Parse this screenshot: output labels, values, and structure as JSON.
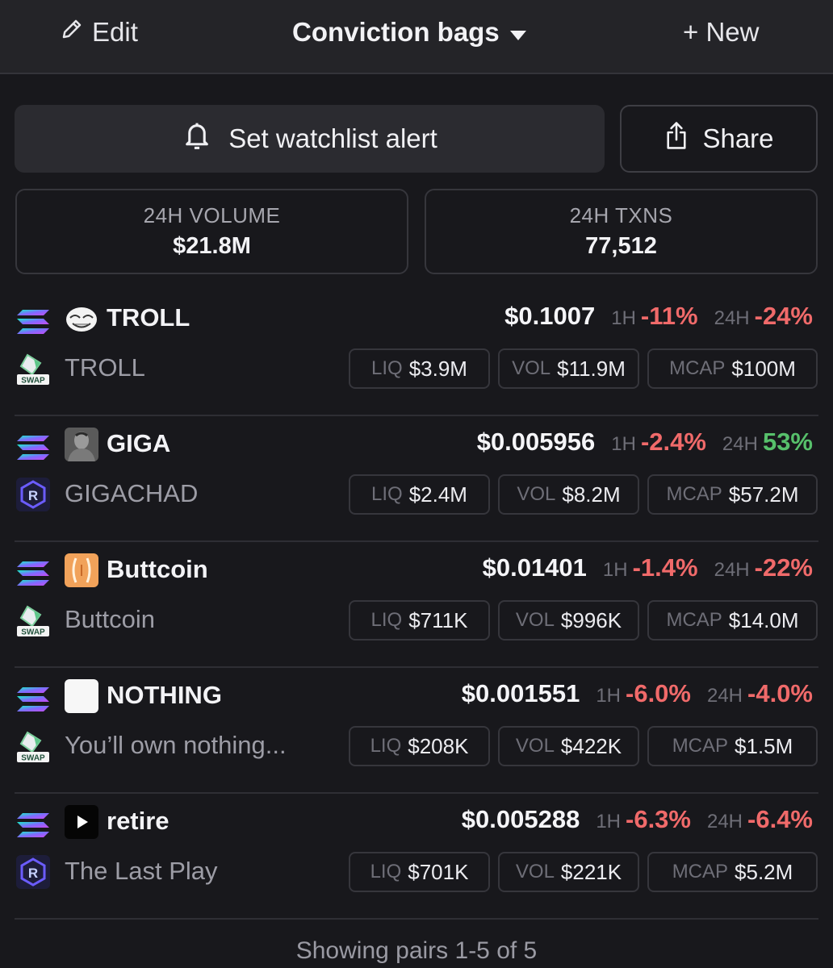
{
  "topbar": {
    "edit_label": "Edit",
    "title": "Conviction bags",
    "new_label": "+ New"
  },
  "actions": {
    "alert_label": "Set watchlist alert",
    "share_label": "Share"
  },
  "stats": {
    "volume_label": "24H VOLUME",
    "volume_value": "$21.8M",
    "txns_label": "24H TXNS",
    "txns_value": "77,512"
  },
  "pairs": [
    {
      "symbol": "TROLL",
      "name": "TROLL",
      "dex": "swap-icon",
      "token_icon": "trollface-icon",
      "price": "$0.1007",
      "h1_label": "1H",
      "h1": "-11%",
      "h1_dir": "neg",
      "h24_label": "24H",
      "h24": "-24%",
      "h24_dir": "neg",
      "liq_label": "LIQ",
      "liq": "$3.9M",
      "vol_label": "VOL",
      "vol": "$11.9M",
      "mcap_label": "MCAP",
      "mcap": "$100M"
    },
    {
      "symbol": "GIGA",
      "name": "GIGACHAD",
      "dex": "raydium-icon",
      "token_icon": "gigachad-icon",
      "price": "$0.005956",
      "h1_label": "1H",
      "h1": "-2.4%",
      "h1_dir": "neg",
      "h24_label": "24H",
      "h24": "53%",
      "h24_dir": "pos",
      "liq_label": "LIQ",
      "liq": "$2.4M",
      "vol_label": "VOL",
      "vol": "$8.2M",
      "mcap_label": "MCAP",
      "mcap": "$57.2M"
    },
    {
      "symbol": "Buttcoin",
      "name": "Buttcoin",
      "dex": "swap-icon",
      "token_icon": "buttcoin-icon",
      "price": "$0.01401",
      "h1_label": "1H",
      "h1": "-1.4%",
      "h1_dir": "neg",
      "h24_label": "24H",
      "h24": "-22%",
      "h24_dir": "neg",
      "liq_label": "LIQ",
      "liq": "$711K",
      "vol_label": "VOL",
      "vol": "$996K",
      "mcap_label": "MCAP",
      "mcap": "$14.0M"
    },
    {
      "symbol": "NOTHING",
      "name": "You’ll own nothing...",
      "dex": "swap-icon",
      "token_icon": "blank-icon",
      "price": "$0.001551",
      "h1_label": "1H",
      "h1": "-6.0%",
      "h1_dir": "neg",
      "h24_label": "24H",
      "h24": "-4.0%",
      "h24_dir": "neg",
      "liq_label": "LIQ",
      "liq": "$208K",
      "vol_label": "VOL",
      "vol": "$422K",
      "mcap_label": "MCAP",
      "mcap": "$1.5M"
    },
    {
      "symbol": "retire",
      "name": "The Last Play",
      "dex": "raydium-icon",
      "token_icon": "play-icon",
      "price": "$0.005288",
      "h1_label": "1H",
      "h1": "-6.3%",
      "h1_dir": "neg",
      "h24_label": "24H",
      "h24": "-6.4%",
      "h24_dir": "neg",
      "liq_label": "LIQ",
      "liq": "$701K",
      "vol_label": "VOL",
      "vol": "$221K",
      "mcap_label": "MCAP",
      "mcap": "$5.2M"
    }
  ],
  "footer": {
    "text": "Showing pairs 1-5 of 5"
  },
  "colors": {
    "background": "#18181c",
    "topbar": "#242428",
    "negative": "#f06a6a",
    "positive": "#57c06b",
    "muted": "#6e6e77"
  }
}
